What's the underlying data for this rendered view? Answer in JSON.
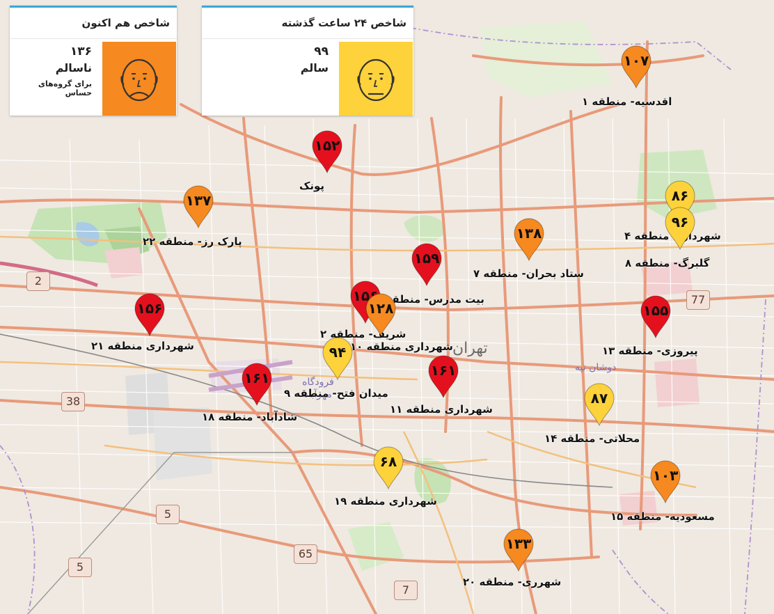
{
  "cards": {
    "now": {
      "title": "شاخص هم اکنون",
      "value": "۱۳۶",
      "status": "ناسالم",
      "substatus": "برای گروه‌های حساس",
      "color": "#f6891f",
      "icon": "sad-face-icon"
    },
    "day": {
      "title": "شاخص ۲۴ ساعت گذشته",
      "value": "۹۹",
      "status": "سالم",
      "color": "#fdd23b",
      "icon": "neutral-face-icon"
    }
  },
  "colors": {
    "red": "#e5101e",
    "orange": "#f6891f",
    "yellow": "#fdd23b"
  },
  "stations": [
    {
      "value": "۱۰۷",
      "label": "اقدسیه- منطقه ۱",
      "color": "orange"
    },
    {
      "value": "۱۵۲",
      "label": "پونک",
      "color": "red"
    },
    {
      "value": "۱۳۷",
      "label": "پارک رز- منطقه ۲۲",
      "color": "orange"
    },
    {
      "value": "۸۶",
      "label": "شهرداری منطقه ۴",
      "color": "yellow"
    },
    {
      "value": "۹۶",
      "label": "گلبرگ- منطقه ۸",
      "color": "yellow"
    },
    {
      "value": "۱۳۸",
      "label": "ستاد بحران- منطقه ۷",
      "color": "orange"
    },
    {
      "value": "۱۵۹",
      "label": "بیت مدرس- منطقه ۶",
      "color": "red"
    },
    {
      "value": "۱۵۶",
      "label": "شریف- منطقه ۲",
      "color": "red"
    },
    {
      "value": "۱۲۸",
      "label": "شهرداری منطقه ۱۰",
      "color": "orange"
    },
    {
      "value": "۱۵۶",
      "label": "شهرداری منطقه ۲۱",
      "color": "red"
    },
    {
      "value": "۱۵۵",
      "label": "پیروزی- منطقه ۱۳",
      "color": "red"
    },
    {
      "value": "۹۴",
      "label": "میدان فتح- منطقه ۹",
      "color": "yellow"
    },
    {
      "value": "۱۶۱",
      "label": "شادآباد- منطقه ۱۸",
      "color": "red"
    },
    {
      "value": "۱۶۱",
      "label": "شهرداری منطقه ۱۱",
      "color": "red"
    },
    {
      "value": "۸۷",
      "label": "محلاتی- منطقه ۱۴",
      "color": "yellow"
    },
    {
      "value": "۶۸",
      "label": "شهرداری منطقه ۱۹",
      "color": "yellow"
    },
    {
      "value": "۱۰۳",
      "label": "مسعودیه- منطقه ۱۵",
      "color": "orange"
    },
    {
      "value": "۱۳۳",
      "label": "شهرری- منطقه ۲۰",
      "color": "orange"
    }
  ],
  "map_labels": {
    "city": "تهران",
    "district": "دوشان تپه",
    "airport": "فرودگاه مهرآباد"
  },
  "road_shields": [
    "2",
    "38",
    "5",
    "5",
    "65",
    "7",
    "77"
  ]
}
